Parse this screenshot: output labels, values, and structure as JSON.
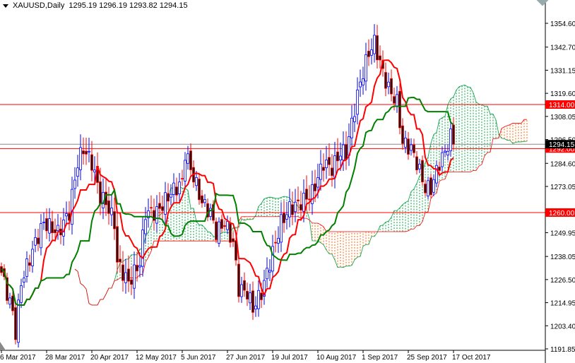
{
  "header": {
    "symbol": "XAUUSD,Daily",
    "ohlc": "1295.19 1296.19 1293.82 1294.15"
  },
  "chart_data": {
    "type": "candlestick",
    "title": "XAUUSD,Daily",
    "indicator": "Ichimoku Kinko Hyo",
    "ylim": [
      1191.85,
      1354.6
    ],
    "y_ticks": [
      "1354.60",
      "1342.70",
      "1331.15",
      "1319.60",
      "1308.05",
      "1296.50",
      "1284.60",
      "1273.05",
      "1249.95",
      "1238.05",
      "1226.50",
      "1214.95",
      "1203.40",
      "1191.85"
    ],
    "x_ticks": [
      {
        "bar": 0,
        "label": "6 Mar 2017"
      },
      {
        "bar": 16,
        "label": "28 Mar 2017"
      },
      {
        "bar": 32,
        "label": "20 Apr 2017"
      },
      {
        "bar": 48,
        "label": "12 May 2017"
      },
      {
        "bar": 64,
        "label": "5 Jun 2017"
      },
      {
        "bar": 80,
        "label": "27 Jun 2017"
      },
      {
        "bar": 96,
        "label": "19 Jul 2017"
      },
      {
        "bar": 112,
        "label": "10 Aug 2017"
      },
      {
        "bar": 128,
        "label": "1 Sep 2017"
      },
      {
        "bar": 144,
        "label": "25 Sep 2017"
      },
      {
        "bar": 160,
        "label": "17 Oct 2017"
      }
    ],
    "close_anchors": [
      [
        0,
        1230
      ],
      [
        4,
        1210
      ],
      [
        5,
        1200
      ],
      [
        7,
        1225
      ],
      [
        12,
        1245
      ],
      [
        15,
        1255
      ],
      [
        20,
        1250
      ],
      [
        24,
        1260
      ],
      [
        27,
        1285
      ],
      [
        29,
        1292
      ],
      [
        32,
        1285
      ],
      [
        35,
        1268
      ],
      [
        37,
        1265
      ],
      [
        40,
        1255
      ],
      [
        41,
        1235
      ],
      [
        45,
        1225
      ],
      [
        49,
        1235
      ],
      [
        51,
        1260
      ],
      [
        55,
        1260
      ],
      [
        60,
        1270
      ],
      [
        64,
        1275
      ],
      [
        65,
        1290
      ],
      [
        67,
        1282
      ],
      [
        71,
        1265
      ],
      [
        74,
        1260
      ],
      [
        76,
        1250
      ],
      [
        79,
        1255
      ],
      [
        82,
        1245
      ],
      [
        84,
        1222
      ],
      [
        87,
        1220
      ],
      [
        89,
        1212
      ],
      [
        92,
        1220
      ],
      [
        95,
        1235
      ],
      [
        99,
        1255
      ],
      [
        102,
        1262
      ],
      [
        106,
        1265
      ],
      [
        110,
        1270
      ],
      [
        114,
        1285
      ],
      [
        117,
        1282
      ],
      [
        120,
        1290
      ],
      [
        122,
        1290
      ],
      [
        125,
        1312
      ],
      [
        127,
        1325
      ],
      [
        130,
        1340
      ],
      [
        132,
        1345
      ],
      [
        135,
        1330
      ],
      [
        137,
        1322
      ],
      [
        140,
        1315
      ],
      [
        142,
        1295
      ],
      [
        145,
        1292
      ],
      [
        147,
        1285
      ],
      [
        150,
        1272
      ],
      [
        152,
        1272
      ],
      [
        155,
        1285
      ],
      [
        157,
        1290
      ],
      [
        159,
        1298
      ],
      [
        160,
        1294.15
      ]
    ],
    "horizontal_lines": [
      {
        "price": 1314.0,
        "label": "1314.00",
        "color": "#ff0000"
      },
      {
        "price": 1292.0,
        "label": "1292.00",
        "color": "#ff0000"
      },
      {
        "price": 1260.0,
        "label": "1260.00",
        "color": "#ff0000"
      },
      {
        "price": 1294.15,
        "label": "1294.15",
        "color": "#000000"
      }
    ],
    "colors": {
      "bull": "#0000ff",
      "bear": "#ff0000",
      "tenkan": "#ff0000",
      "kijun": "#008000",
      "cloud_up": "#00a040",
      "cloud_down": "#ff6000"
    }
  }
}
